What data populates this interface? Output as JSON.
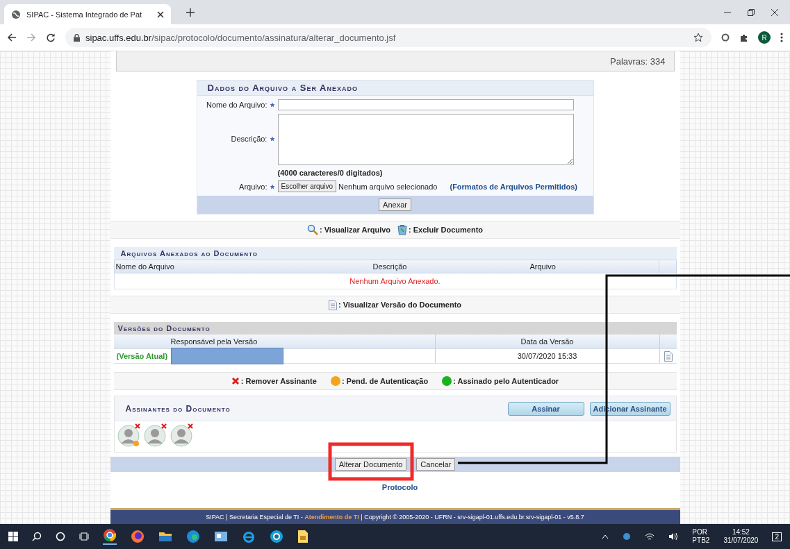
{
  "browser": {
    "tab_title": "SIPAC - Sistema Integrado de Pat",
    "url_host": "sipac.uffs.edu.br",
    "url_path": "/sipac/protocolo/documento/assinatura/alterar_documento.jsf",
    "profile_initial": "R"
  },
  "editor": {
    "word_count": "Palavras: 334"
  },
  "attach_form": {
    "title": "Dados do Arquivo a Ser Anexado",
    "name_label": "Nome do Arquivo:",
    "description_label": "Descrição:",
    "char_count": "(4000 caracteres/0 digitados)",
    "file_label": "Arquivo:",
    "choose_button": "Escolher arquivo",
    "no_file": "Nenhum arquivo selecionado",
    "formats_link": "(Formatos de Arquivos Permitidos)",
    "attach_button": "Anexar"
  },
  "legend_files": [
    {
      "kind": "view",
      "label": ": Visualizar Arquivo"
    },
    {
      "kind": "delete",
      "label": ": Excluir Documento"
    }
  ],
  "attached": {
    "title": "Arquivos Anexados ao Documento",
    "columns": [
      "Nome do Arquivo",
      "Descrição",
      "Arquivo"
    ],
    "empty": "Nenhum Arquivo Anexado."
  },
  "legend_version": ": Visualizar Versão do Documento",
  "versions": {
    "title": "Versões do Documento",
    "columns": [
      "Responsável pela Versão",
      "Data da Versão"
    ],
    "rows": [
      {
        "label": "(Versão Atual)",
        "date": "30/07/2020 15:33"
      }
    ]
  },
  "legend_signers": [
    {
      "kind": "remove",
      "label": ": Remover Assinante"
    },
    {
      "kind": "pending",
      "label": ": Pend. de Autenticação"
    },
    {
      "kind": "signed",
      "label": ": Assinado pelo Autenticador"
    }
  ],
  "signers": {
    "title": "Assinantes do Documento",
    "buttons": [
      "Assinar",
      "Adicionar Assinante"
    ],
    "items": [
      {
        "pending": true
      },
      {
        "pending": false
      },
      {
        "pending": false
      }
    ]
  },
  "actions": [
    "Alterar Documento",
    "Cancelar"
  ],
  "breadcrumb": "Protocolo",
  "footer": {
    "left": "SIPAC | Secretaria Especial de TI - ",
    "link": "Atendimento de TI",
    "right": " | Copyright © 2005-2020 - UFRN - srv-sigapl-01.uffs.edu.br.srv-sigapl-01 - v5.8.7"
  },
  "taskbar": {
    "language": "POR",
    "layout": "PTB2",
    "time": "14:52",
    "date": "31/07/2020",
    "notifications": "2"
  }
}
